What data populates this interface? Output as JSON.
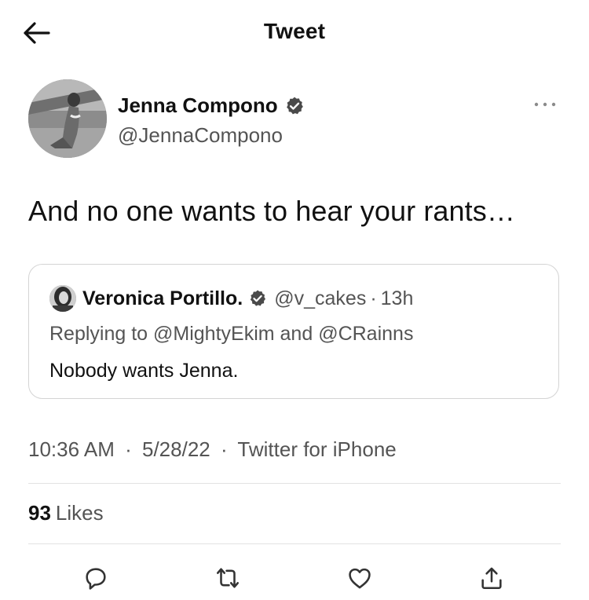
{
  "header": {
    "title": "Tweet",
    "back_icon": "arrow-left-icon"
  },
  "author": {
    "name": "Jenna Compono",
    "handle": "@JennaCompono",
    "verified": true,
    "more_icon": "more-horizontal-icon"
  },
  "tweet": {
    "text": "And no one wants to hear your rants…"
  },
  "quoted_tweet": {
    "name": "Veronica Portillo.",
    "verified": true,
    "handle": "@v_cakes",
    "separator": "·",
    "time": "13h",
    "replying_to": "Replying to @MightyEkim and @CRainns",
    "text": "Nobody wants Jenna."
  },
  "meta": {
    "time": "10:36 AM",
    "sep1": "·",
    "date": "5/28/22",
    "sep2": "·",
    "source": "Twitter for iPhone"
  },
  "stats": {
    "likes_count": "93",
    "likes_label": "Likes"
  },
  "actions": {
    "reply_icon": "reply-icon",
    "retweet_icon": "retweet-icon",
    "like_icon": "heart-icon",
    "share_icon": "share-icon"
  },
  "colors": {
    "text_primary": "#111111",
    "text_secondary": "#545454",
    "border": "#d4d4d4",
    "background": "#ffffff"
  }
}
